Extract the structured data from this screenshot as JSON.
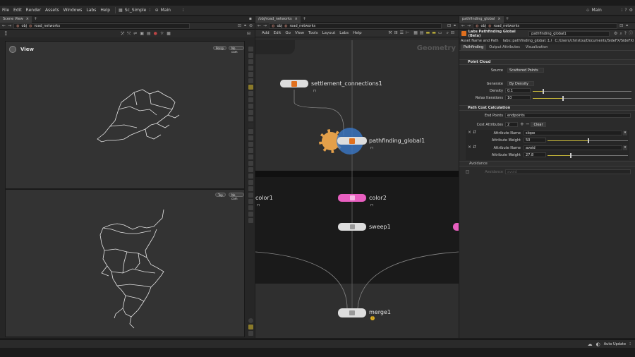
{
  "menu": {
    "items": [
      "File",
      "Edit",
      "Render",
      "Assets",
      "Windows",
      "Labs",
      "Help"
    ],
    "desktop": "Sc_Simple",
    "main_label": "Main"
  },
  "right_bar": {
    "main_label": "Main"
  },
  "scene": {
    "tab_label": "Scene View",
    "path_root": "obj",
    "path_node": "road_networks",
    "viewport_top": {
      "title": "View",
      "camera_mode": "Persp",
      "camera": "No cam"
    },
    "viewport_bottom": {
      "camera_mode": "Top",
      "camera": "No cam"
    }
  },
  "network": {
    "tab_label": "/obj/road_networks",
    "path_root": "obj",
    "path_node": "road_networks",
    "menu": [
      "Add",
      "Edit",
      "Go",
      "View",
      "Tools",
      "Layout",
      "Labs",
      "Help"
    ],
    "context_label": "Geometry",
    "nodes": {
      "settlement": "settlement_connections1",
      "pathfinding": "pathfinding_global1",
      "color1": "color1",
      "color2": "color2",
      "sweep": "sweep1",
      "merge": "merge1"
    }
  },
  "params": {
    "tab_label": "pathfinding_global",
    "path_root": "obj",
    "path_node": "road_networks",
    "node_type": "Labs Pathfinding Global (Beta)",
    "node_name": "pathfinding_global1",
    "asset_name_label": "Asset Name and Path",
    "asset_name": "labs::pathfinding_global::1.0",
    "asset_path": "C:/Users/christou/Documents/SideFX/SideFXLab...",
    "tabs": [
      "Pathfinding",
      "Output Attributes",
      "Visualization"
    ],
    "point_cloud": {
      "header": "Point Cloud",
      "source_label": "Source",
      "source_value": "Scattered Points",
      "generate_label": "Generate",
      "generate_value": "By Density",
      "density_label": "Density",
      "density_value": "0.1",
      "density_level": 0.1,
      "relax_label": "Relax Iterations",
      "relax_value": "10",
      "relax_level": 0.3
    },
    "path_cost": {
      "header": "Path Cost Calculation",
      "endpoints_label": "End Points",
      "endpoints_value": "endpoints",
      "cost_attr_label": "Cost Attributes",
      "cost_attr_value": "2",
      "clear_label": "Clear",
      "attr1_name_label": "Attribute Name",
      "attr1_name": "slope",
      "attr1_weight_label": "Attribute Weight",
      "attr1_weight": "50",
      "attr1_level": 0.5,
      "attr2_name_label": "Attribute Name",
      "attr2_name": "avoid",
      "attr2_weight_label": "Attribute Weight",
      "attr2_weight": "27.8",
      "attr2_level": 0.28
    },
    "avoidance": {
      "header": "Avoidance",
      "label": "Avoidance",
      "value": "avoid"
    }
  },
  "statusbar": {
    "auto_update": "Auto Update"
  },
  "colors": {
    "accent": "#c8b93a",
    "node_pink": "#e85fc0",
    "node_orange": "#e0701e",
    "node_blue": "#3a78c8"
  }
}
